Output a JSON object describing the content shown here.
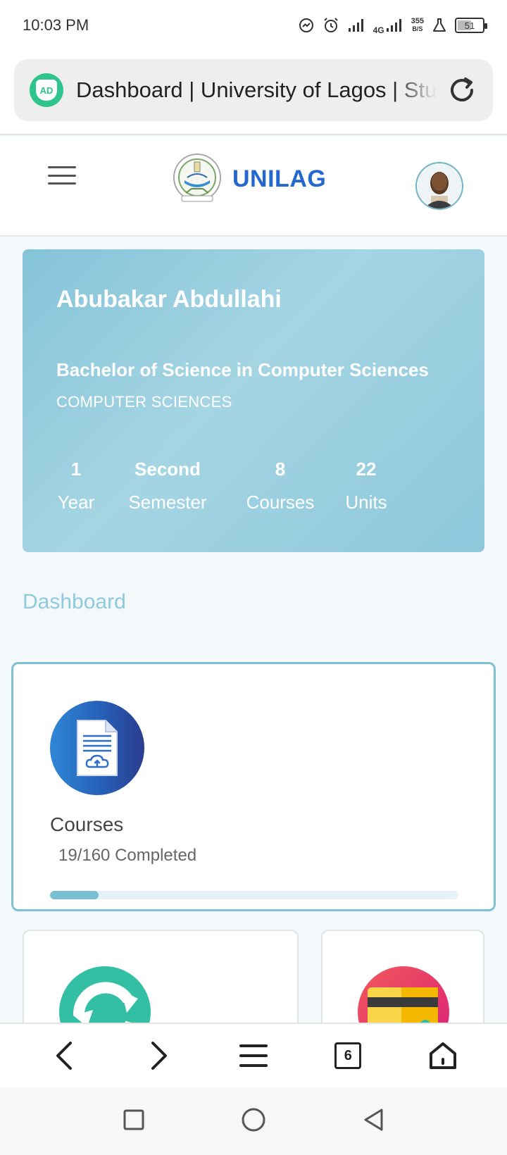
{
  "status_bar": {
    "time": "10:03 PM",
    "network": "4G",
    "speed_value": "355",
    "speed_unit": "B/S",
    "battery": "51"
  },
  "browser": {
    "page_title": "Dashboard | University of Lagos | Student Portal",
    "ad_badge": "AD",
    "tab_count": "6"
  },
  "header": {
    "brand": "UNILAG"
  },
  "profile": {
    "name": "Abubakar Abdullahi",
    "program": "Bachelor of Science in Computer Sciences",
    "department": "COMPUTER SCIENCES",
    "stats": [
      {
        "value": "1",
        "label": "Year"
      },
      {
        "value": "Second",
        "label": "Semester"
      },
      {
        "value": "8",
        "label": "Courses"
      },
      {
        "value": "22",
        "label": "Units"
      }
    ]
  },
  "dashboard": {
    "section_title": "Dashboard",
    "courses_card": {
      "title": "Courses",
      "completed_text": "19/160 Completed",
      "progress_fraction": 0.119
    }
  },
  "colors": {
    "brand_blue": "#2467d0",
    "accent_teal": "#7ec0d4",
    "card_gradient_start": "#84c3d8",
    "sync_green": "#33bfa3",
    "payment_red": "#f05a5a"
  },
  "icons": {
    "top_left_status": [
      "messenger-icon",
      "alarm-icon",
      "signal-icon",
      "signal-icon",
      "lab-flask-icon"
    ],
    "bottom_nav": [
      "back-icon",
      "forward-icon",
      "menu-icon",
      "tabs-icon",
      "home-icon"
    ],
    "system_nav": [
      "recent-apps-icon",
      "home-circle-icon",
      "back-triangle-icon"
    ]
  }
}
